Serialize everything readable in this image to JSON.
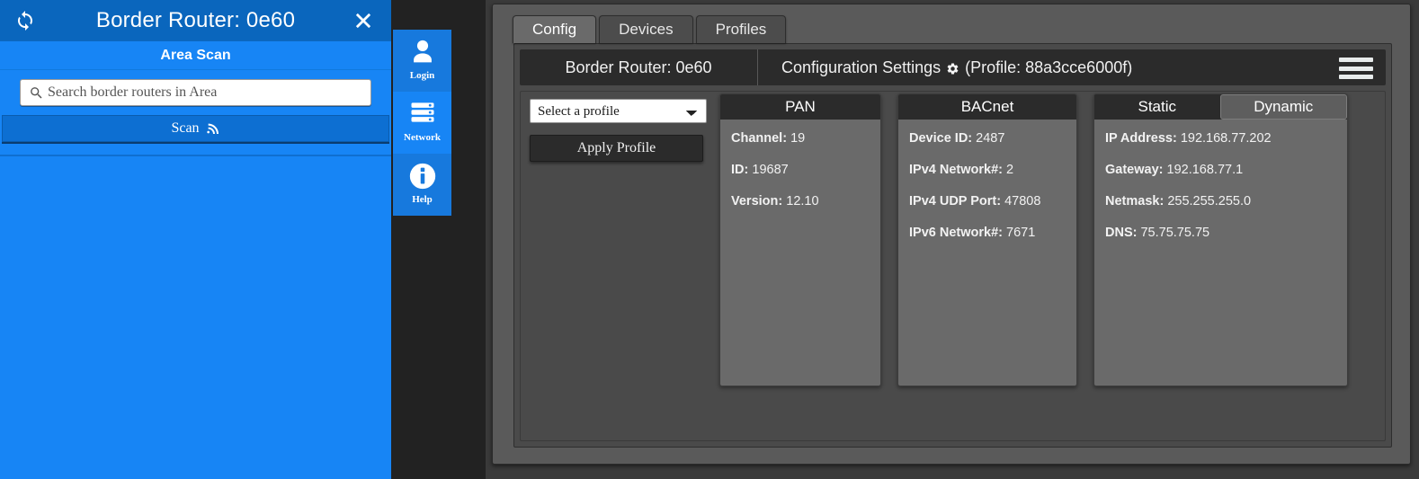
{
  "left_panel": {
    "title": "Border Router: 0e60",
    "refresh_icon": "refresh-icon",
    "close_icon": "close-icon",
    "banner": "Area Scan",
    "search_placeholder": "Search border routers in Area",
    "search_value": "",
    "scan_button": "Scan",
    "scan_icon": "signal-icon"
  },
  "rail": {
    "items": [
      {
        "label": "Login",
        "icon": "user-icon",
        "active": false
      },
      {
        "label": "Network",
        "icon": "server-icon",
        "active": true
      },
      {
        "label": "Help",
        "icon": "info-icon",
        "active": false
      }
    ]
  },
  "tabs": [
    {
      "label": "Config",
      "active": true
    },
    {
      "label": "Devices",
      "active": false
    },
    {
      "label": "Profiles",
      "active": false
    }
  ],
  "header": {
    "router": "Border Router: 0e60",
    "settings_title": "Configuration Settings",
    "gear_icon": "gear-icon",
    "profile_text": "(Profile: 88a3cce6000f)",
    "menu_icon": "hamburger-icon"
  },
  "profile_section": {
    "select_value": "Select a profile",
    "options": [
      "Select a profile"
    ],
    "apply_label": "Apply Profile"
  },
  "panels": {
    "pan": {
      "title": "PAN",
      "fields": [
        {
          "key": "Channel:",
          "value": "19"
        },
        {
          "key": "ID:",
          "value": "19687"
        },
        {
          "key": "Version:",
          "value": "12.10"
        }
      ]
    },
    "bacnet": {
      "title": "BACnet",
      "fields": [
        {
          "key": "Device ID:",
          "value": "2487"
        },
        {
          "key": "IPv4 Network#:",
          "value": "2"
        },
        {
          "key": "IPv4 UDP Port:",
          "value": "47808"
        },
        {
          "key": "IPv6 Network#:",
          "value": "7671"
        }
      ]
    },
    "network": {
      "segments": [
        {
          "label": "Static",
          "active": false
        },
        {
          "label": "Dynamic",
          "active": true
        }
      ],
      "fields": [
        {
          "key": "IP Address:",
          "value": "192.168.77.202"
        },
        {
          "key": "Gateway:",
          "value": "192.168.77.1"
        },
        {
          "key": "Netmask:",
          "value": "255.255.255.0"
        },
        {
          "key": "DNS:",
          "value": "75.75.75.75"
        }
      ]
    }
  },
  "colors": {
    "brand_blue": "#1785f5",
    "header_blue": "#0a66bd",
    "dark_bg": "#3a3a3a",
    "panel_gray": "#6a6a6a",
    "panel_head": "#2b2b2b"
  }
}
